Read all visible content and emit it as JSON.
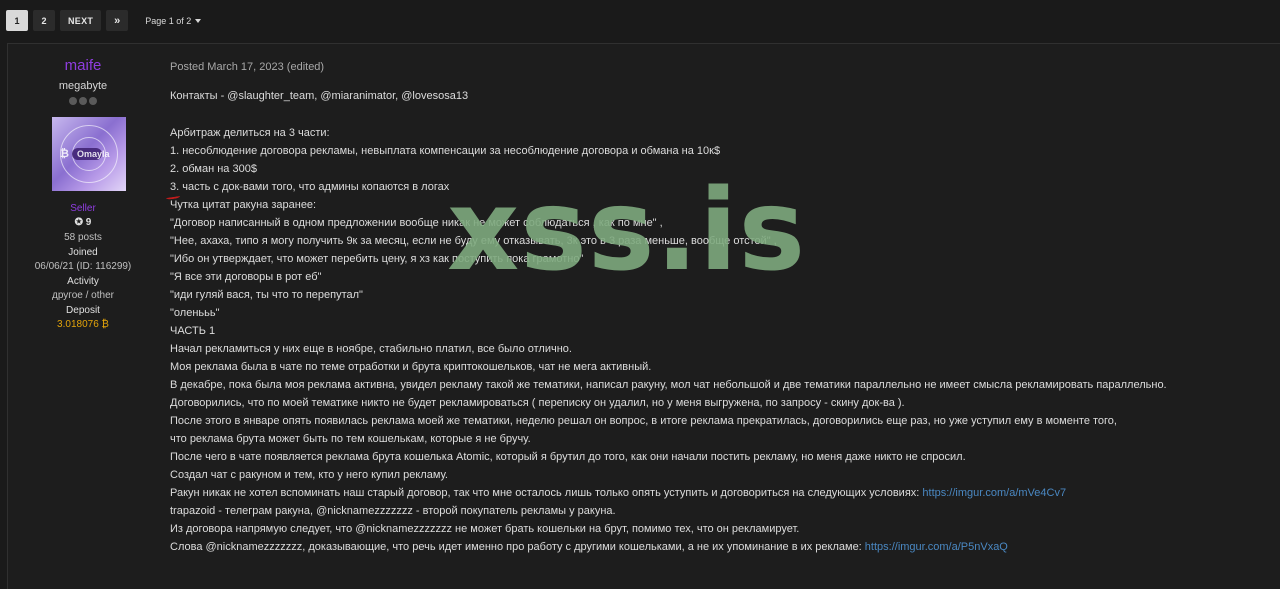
{
  "pagination": {
    "pages": [
      "1",
      "2"
    ],
    "active": "1",
    "next_label": "NEXT",
    "last_label": "»",
    "page_jump": "Page 1 of 2"
  },
  "author": {
    "name": "maife",
    "title": "megabyte",
    "avatar_text": "Omayla",
    "group": "Seller",
    "reputation": "9",
    "posts": "58 posts",
    "joined_label": "Joined",
    "joined_value": "06/06/21 (ID: 116299)",
    "activity_label": "Activity",
    "activity_value": "другое / other",
    "deposit_label": "Deposit",
    "deposit_value": "3.018076 ₿"
  },
  "post": {
    "posted": "Posted March 17, 2023 (edited)",
    "lines": [
      {
        "text": "Контакты - @slaughter_team, @miaranimator, @lovesosa13",
        "link": ""
      },
      {
        "text": "Арбитраж делиться на 3 части:",
        "link": ""
      },
      {
        "text": "1. несоблюдение договора рекламы, невыплата компенсации за несоблюдение договора и обмана на 10к$",
        "link": ""
      },
      {
        "text": "2. обман на 300$",
        "link": ""
      },
      {
        "text": "3. часть с док-вами того, что админы копаются в логах",
        "link": ""
      },
      {
        "text": "Чутка цитат ракуна заранее:",
        "link": ""
      },
      {
        "text": "\"Договор  написанный в одном предложении вообще никак не может соблюдаться , как по мне\" ,",
        "link": ""
      },
      {
        "text": "\"Нее, ахаха, типо я могу получить 9к за месяц, если не буду ему отказывать, 3к это в 3 раза меньше, вообще отстой\" ,",
        "link": ""
      },
      {
        "text": "\"Ибо он утверждает, что может перебить цену, я  хз как поступить пока грамотно\"",
        "link": ""
      },
      {
        "text": "\"Я все эти договоры в рот еб\"",
        "link": ""
      },
      {
        "text": "\"иди гуляй вася, ты что то перепутал\"",
        "link": ""
      },
      {
        "text": "\"оленььь\"",
        "link": ""
      },
      {
        "text": "ЧАСТЬ 1",
        "link": ""
      },
      {
        "text": "Начал рекламиться у них еще в ноябре, стабильно платил, все было отлично.",
        "link": ""
      },
      {
        "text": "Моя реклама была в чате по теме отработки и брута криптокошельков, чат не мега активный.",
        "link": ""
      },
      {
        "text": "В декабре, пока была моя реклама активна, увидел рекламу такой же тематики, написал ракуну, мол чат небольшой и две тематики параллельно не имеет смысла рекламировать параллельно.",
        "link": ""
      },
      {
        "text": "Договорились, что по моей тематике никто не будет рекламироваться ( переписку он удалил, но у меня выгружена, по запросу - скину док-ва ).",
        "link": ""
      },
      {
        "text": "После этого в январе опять появилась реклама моей же тематики, неделю решал он вопрос, в итоге реклама прекратилась, договорились еще раз, но уже уступил ему в моменте того,",
        "link": ""
      },
      {
        "text": "что реклама брута может быть по тем кошелькам, которые я не бручу.",
        "link": ""
      },
      {
        "text": "После чего в чате появляется реклама брута кошелька Atomic, который я брутил до того, как они начали постить рекламу, но меня даже никто не спросил.",
        "link": ""
      },
      {
        "text": "Создал чат с ракуном и тем, кто у него купил рекламу.",
        "link": ""
      },
      {
        "text": "Ракун никак не хотел вспоминать наш старый договор, так что мне осталось лишь только опять уступить и договориться на следующих условиях: ",
        "link": "https://imgur.com/a/mVe4Cv7"
      },
      {
        "text": "trapazoid - телеграм ракуна, @nicknamezzzzzzz - второй покупатель рекламы у ракуна.",
        "link": ""
      },
      {
        "text": "Из договора напрямую следует, что @nicknamezzzzzzz не может брать кошельки на брут, помимо тех, что он рекламирует.",
        "link": ""
      },
      {
        "text": "Слова @nicknamezzzzzzz, доказывающие, что речь идет именно про работу с другими кошельками, а не их упоминание в их рекламе: ",
        "link": "https://imgur.com/a/P5nVxaQ"
      }
    ]
  },
  "watermark": "xss.is",
  "colors": {
    "username": "#8f3de0",
    "link": "#4a88c2",
    "deposit": "#e3a40a",
    "watermark": "#7eaa7e"
  }
}
